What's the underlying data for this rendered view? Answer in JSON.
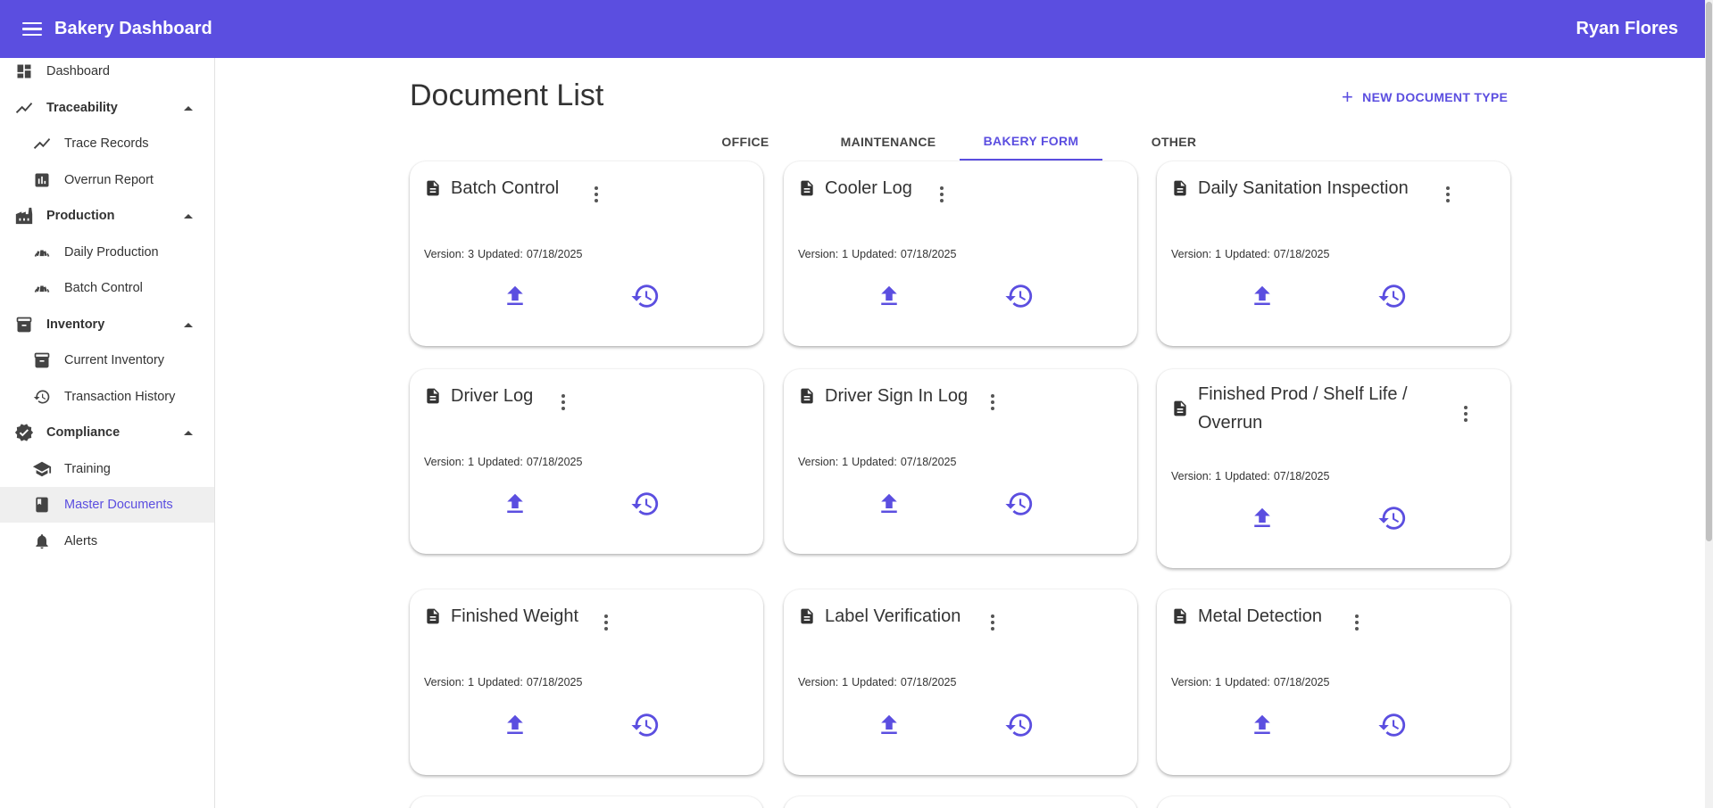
{
  "header": {
    "app_title": "Bakery Dashboard",
    "user_name": "Ryan Flores"
  },
  "sidebar": {
    "items": [
      {
        "label": "Dashboard",
        "icon": "dashboard-icon",
        "type": "item"
      },
      {
        "label": "Traceability",
        "icon": "trending-icon",
        "type": "section"
      },
      {
        "label": "Trace Records",
        "icon": "trending-icon",
        "type": "sub"
      },
      {
        "label": "Overrun Report",
        "icon": "bar-chart-icon",
        "type": "sub"
      },
      {
        "label": "Production",
        "icon": "factory-icon",
        "type": "section"
      },
      {
        "label": "Daily Production",
        "icon": "bakery-icon",
        "type": "sub"
      },
      {
        "label": "Batch Control",
        "icon": "bakery-icon",
        "type": "sub"
      },
      {
        "label": "Inventory",
        "icon": "inventory-icon",
        "type": "section"
      },
      {
        "label": "Current Inventory",
        "icon": "inventory-icon",
        "type": "sub"
      },
      {
        "label": "Transaction History",
        "icon": "history-icon",
        "type": "sub"
      },
      {
        "label": "Compliance",
        "icon": "verified-icon",
        "type": "section"
      },
      {
        "label": "Training",
        "icon": "school-icon",
        "type": "sub"
      },
      {
        "label": "Master Documents",
        "icon": "book-icon",
        "type": "sub",
        "active": true
      },
      {
        "label": "Alerts",
        "icon": "bell-icon",
        "type": "sub"
      }
    ]
  },
  "main": {
    "title": "Document List",
    "new_document_label": "NEW DOCUMENT TYPE",
    "tabs": [
      {
        "label": "OFFICE"
      },
      {
        "label": "MAINTENANCE"
      },
      {
        "label": "BAKERY FORM",
        "active": true
      },
      {
        "label": "OTHER"
      }
    ],
    "meta_labels": {
      "version": "Version:",
      "updated": "Updated:"
    },
    "documents": [
      {
        "title": "Batch Control",
        "version": "3",
        "updated": "07/18/2025"
      },
      {
        "title": "Cooler Log",
        "version": "1",
        "updated": "07/18/2025"
      },
      {
        "title": "Daily Sanitation Inspection",
        "version": "1",
        "updated": "07/18/2025"
      },
      {
        "title": "Driver Log",
        "version": "1",
        "updated": "07/18/2025"
      },
      {
        "title": "Driver Sign In Log",
        "version": "1",
        "updated": "07/18/2025"
      },
      {
        "title": "Finished Prod / Shelf Life / Overrun",
        "version": "1",
        "updated": "07/18/2025"
      },
      {
        "title": "Finished Weight",
        "version": "1",
        "updated": "07/18/2025"
      },
      {
        "title": "Label Verification",
        "version": "1",
        "updated": "07/18/2025"
      },
      {
        "title": "Metal Detection",
        "version": "1",
        "updated": "07/18/2025"
      }
    ]
  },
  "colors": {
    "primary": "#5b4ee0",
    "active_bg": "#efefef"
  }
}
